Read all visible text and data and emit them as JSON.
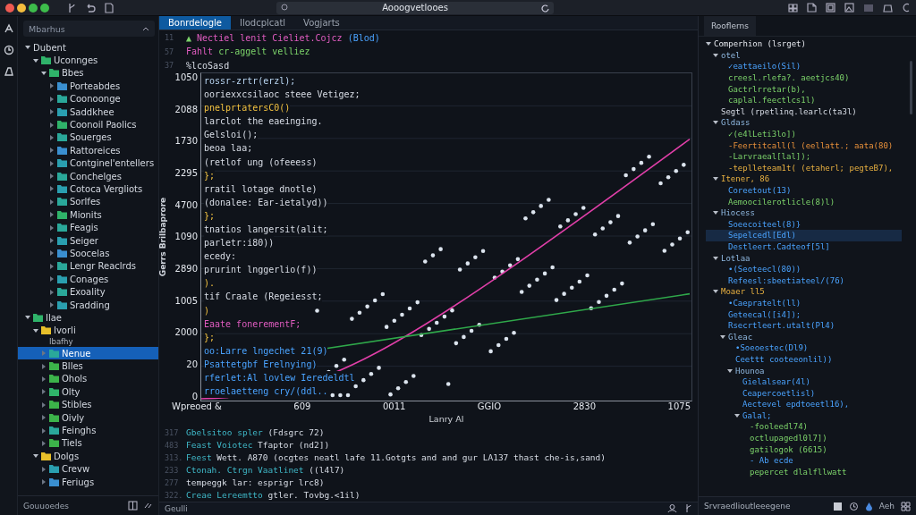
{
  "titlebar": {
    "search_value": "Aooogvetlooes"
  },
  "sidebar": {
    "search_placeholder": "Mbarhus",
    "status": "Gouuoedes",
    "tree": [
      {
        "label": "Dubent",
        "expanded": true,
        "selected": false,
        "children": [
          {
            "label": "Uconnges",
            "expanded": true,
            "selected": false,
            "color": "#2fb36a",
            "children": [
              {
                "label": "Bbes",
                "expanded": true,
                "selected": false,
                "color": "#2fb36a",
                "children": [
                  {
                    "label": "Porteabdes",
                    "expanded": false,
                    "selected": false,
                    "color": "#3a8fd0"
                  },
                  {
                    "label": "Coonoonge",
                    "expanded": false,
                    "selected": false,
                    "color": "#2aa89a"
                  },
                  {
                    "label": "Saddkhee",
                    "expanded": false,
                    "selected": false,
                    "color": "#2a9fb0"
                  },
                  {
                    "label": "Coonoil Paolics",
                    "expanded": false,
                    "selected": false,
                    "color": "#2fb36a"
                  },
                  {
                    "label": "Souerges",
                    "expanded": false,
                    "selected": false,
                    "color": "#2aa89a"
                  },
                  {
                    "label": "Rattoreices",
                    "expanded": false,
                    "selected": false,
                    "color": "#3a8fd0"
                  },
                  {
                    "label": "Contginel'entellers",
                    "expanded": false,
                    "selected": false,
                    "color": "#2a9fb0"
                  },
                  {
                    "label": "Conchelges",
                    "expanded": false,
                    "selected": false,
                    "color": "#2aa89a"
                  },
                  {
                    "label": "Cotoca Vergliots",
                    "expanded": false,
                    "selected": false,
                    "color": "#2a9fb0"
                  },
                  {
                    "label": "Sorlfes",
                    "expanded": false,
                    "selected": false,
                    "color": "#2aa89a"
                  },
                  {
                    "label": "Mionits",
                    "expanded": false,
                    "selected": false,
                    "color": "#2fb36a"
                  },
                  {
                    "label": "Feagis",
                    "expanded": false,
                    "selected": false,
                    "color": "#2aa89a"
                  },
                  {
                    "label": "Seiger",
                    "expanded": false,
                    "selected": false,
                    "color": "#2a9fb0"
                  },
                  {
                    "label": "Soocelas",
                    "expanded": false,
                    "selected": false,
                    "color": "#3a8fd0"
                  },
                  {
                    "label": "Lengr Reaclrds",
                    "expanded": false,
                    "selected": false,
                    "color": "#2aa89a"
                  },
                  {
                    "label": "Conages",
                    "expanded": false,
                    "selected": false,
                    "color": "#2a9fb0"
                  },
                  {
                    "label": "Exoality",
                    "expanded": false,
                    "selected": false,
                    "color": "#2aa89a"
                  },
                  {
                    "label": "Sradding",
                    "expanded": false,
                    "selected": false,
                    "color": "#2a9fb0"
                  }
                ]
              }
            ]
          }
        ]
      },
      {
        "label": "Ilae",
        "expanded": true,
        "selected": false,
        "color": "#2fb36a",
        "children": [
          {
            "label": "Ivorli",
            "detail": "Ibafhy",
            "expanded": true,
            "selected": false,
            "color": "#e8c02a",
            "children": [
              {
                "label": "Nenue",
                "expanded": false,
                "selected": true,
                "color": "#2aa89a"
              },
              {
                "label": "Blles",
                "expanded": false,
                "selected": false,
                "color": "#3cb34a"
              },
              {
                "label": "Ohols",
                "expanded": false,
                "selected": false,
                "color": "#3cb34a"
              },
              {
                "label": "Olty",
                "expanded": false,
                "selected": false,
                "color": "#2fb36a"
              },
              {
                "label": "Stibles",
                "expanded": false,
                "selected": false,
                "color": "#3cb34a"
              },
              {
                "label": "Oivly",
                "expanded": false,
                "selected": false,
                "color": "#3cb34a"
              },
              {
                "label": "Feinghs",
                "expanded": false,
                "selected": false,
                "color": "#2aa89a"
              },
              {
                "label": "Tiels",
                "expanded": false,
                "selected": false,
                "color": "#3cb34a"
              }
            ]
          },
          {
            "label": "Dolgs",
            "expanded": true,
            "selected": false,
            "color": "#e8c02a",
            "children": [
              {
                "label": "Crevw",
                "expanded": false,
                "selected": false,
                "color": "#2a9fb0"
              },
              {
                "label": "Feriugs",
                "expanded": false,
                "selected": false,
                "color": "#3a8fd0"
              }
            ]
          }
        ]
      }
    ]
  },
  "editor": {
    "tabs": [
      {
        "label": "Bonrdelogle",
        "selected": true
      },
      {
        "label": "Ilodcplcatl",
        "selected": false
      },
      {
        "label": "Vogjarts",
        "selected": false
      }
    ],
    "top_lines": [
      {
        "number": "11",
        "segments": [
          {
            "text": "▲ ",
            "kind": "string"
          },
          {
            "text": "Nectiel lenit Cieliet.Cojcz ",
            "kind": "keyword"
          },
          {
            "text": "(Blod)",
            "kind": "func"
          }
        ]
      },
      {
        "number": "57",
        "segments": [
          {
            "text": "Fahlt ",
            "kind": "keyword"
          },
          {
            "text": "cr-aggelt velliez",
            "kind": "string"
          }
        ]
      },
      {
        "number": "37",
        "segments": [
          {
            "text": "%lcoSasd",
            "kind": "plain"
          }
        ]
      }
    ],
    "chart": {
      "ylabel": "Gerrs Brilbaprore",
      "xlabel": "Lanry Al",
      "y_tick_labels": [
        "1050",
        "2088",
        "1730",
        "2295",
        "4700",
        "1090",
        "2890",
        "1005",
        "2000",
        "20",
        "0"
      ],
      "x_tick_labels": [
        "Wpreoed &",
        "609",
        "0011",
        "GGIO",
        "2830",
        "1075"
      ],
      "code_lines": [
        {
          "segments": [
            {
              "text": "rossr-zrtr(erzl);",
              "kind": "light"
            }
          ]
        },
        {
          "segments": [
            {
              "text": "ooriexxcsilaoc steee Vetigez;",
              "kind": "plain"
            }
          ]
        },
        {
          "segments": [
            {
              "text": "pnelprtatersC0()",
              "kind": "punct"
            }
          ]
        },
        {
          "segments": [
            {
              "text": "larclot the eaeinging.",
              "kind": "plain"
            }
          ]
        },
        {
          "segments": [
            {
              "text": "Gelsloi();",
              "kind": "plain"
            }
          ]
        },
        {
          "segments": [
            {
              "text": "beoa laa;",
              "kind": "plain"
            }
          ]
        },
        {
          "segments": [
            {
              "text": "(retlof ung (ofeeess)",
              "kind": "plain"
            }
          ]
        },
        {
          "segments": [
            {
              "text": "};",
              "kind": "punct"
            }
          ]
        },
        {
          "segments": [
            {
              "text": "rratil lotage dnotle)",
              "kind": "plain"
            }
          ]
        },
        {
          "segments": [
            {
              "text": "(donalee: Ear-ietalyd))",
              "kind": "plain"
            }
          ]
        },
        {
          "segments": [
            {
              "text": "};",
              "kind": "punct"
            }
          ]
        },
        {
          "segments": [
            {
              "text": "tnatios langersit(alit;",
              "kind": "plain"
            }
          ]
        },
        {
          "segments": [
            {
              "text": "parletr:i80))",
              "kind": "plain"
            }
          ]
        },
        {
          "segments": [
            {
              "text": "ecedy:",
              "kind": "plain"
            }
          ]
        },
        {
          "segments": [
            {
              "text": "prurint lnggerlio(f))",
              "kind": "plain"
            }
          ]
        },
        {
          "segments": [
            {
              "text": ").",
              "kind": "punct"
            }
          ]
        },
        {
          "segments": [
            {
              "text": "tif Craale (Regeiesst;",
              "kind": "plain"
            }
          ]
        },
        {
          "segments": [
            {
              "text": ")",
              "kind": "punct"
            }
          ]
        },
        {
          "segments": [
            {
              "text": "Eaate fonerementF;",
              "kind": "keyword"
            }
          ]
        },
        {
          "segments": [
            {
              "text": "};",
              "kind": "punct"
            }
          ]
        },
        {
          "segments": [
            {
              "text": "oo:Larre lngechet 21(9)",
              "kind": "func"
            }
          ]
        },
        {
          "segments": [
            {
              "text": "Psattetgbf Erelnying)",
              "kind": "func"
            }
          ]
        },
        {
          "segments": [
            {
              "text": "rferlet:Al lovlew Ieredeldtl",
              "kind": "func"
            }
          ]
        },
        {
          "segments": [
            {
              "text": "rroelaetteng cry/(ddl..",
              "kind": "func"
            }
          ]
        }
      ]
    },
    "bottom_lines": [
      {
        "number": "317",
        "segments": [
          {
            "text": "Gbelsitoo spler ",
            "kind": "type"
          },
          {
            "text": "(Fdsgrc 72)",
            "kind": "plain"
          }
        ]
      },
      {
        "number": "483",
        "segments": [
          {
            "text": "Feast Voiotec ",
            "kind": "type"
          },
          {
            "text": "Tfaptor (nd2])",
            "kind": "plain"
          }
        ]
      },
      {
        "number": "313.",
        "segments": [
          {
            "text": "Feest ",
            "kind": "type"
          },
          {
            "text": "Wett. A870 (ocgtes neatl lafe 11.Gotgts and and gur LA137 thast che-is,sand)",
            "kind": "plain"
          }
        ]
      },
      {
        "number": "233",
        "segments": [
          {
            "text": "Ctonah. Ctrgn Vaatlinet ",
            "kind": "type"
          },
          {
            "text": "((l4l7)",
            "kind": "plain"
          }
        ]
      },
      {
        "number": "277",
        "segments": [
          {
            "text": "tempeggk lar: esprigr lrc8)",
            "kind": "plain"
          }
        ]
      },
      {
        "number": "322.",
        "segments": [
          {
            "text": "Creae Lereemtto ",
            "kind": "type"
          },
          {
            "text": "gtler. Tovbg.<1il)",
            "kind": "plain"
          }
        ]
      }
    ],
    "status": "Geulli"
  },
  "outline": {
    "tab": "Rooflerns",
    "status": "Srvraedlioutleeegene",
    "status_right": "Aeh",
    "items": [
      {
        "text": "Comperhion (lsrget)",
        "kind": "title",
        "expanded": true,
        "selected": false,
        "children": [
          {
            "text": "otel",
            "kind": "group",
            "expanded": true,
            "selected": false,
            "children": [
              {
                "text": "✓eattaeilo(Sil)",
                "kind": "func",
                "selected": false
              },
              {
                "text": "creesl.rlefa?. aeetjcs40)",
                "kind": "string",
                "selected": false
              },
              {
                "text": "Gactrlrretar(b),",
                "kind": "string",
                "selected": false
              },
              {
                "text": "caplal.feectlcs1l)",
                "kind": "string",
                "selected": false
              }
            ]
          },
          {
            "text": "Segtl (rpetlinq.learlc(ta3l)",
            "kind": "plain",
            "selected": false
          },
          {
            "text": "Gldass",
            "kind": "group",
            "expanded": true,
            "selected": false,
            "children": [
              {
                "text": "✓(e4lLeti3lo])",
                "kind": "string",
                "selected": false
              },
              {
                "text": "-Feertitcall(l (eellatt.; aata(80)",
                "kind": "number",
                "selected": false
              },
              {
                "text": "-Larvraeal[lal]);",
                "kind": "string",
                "selected": false
              },
              {
                "text": "-teplleteam1t( (etaherl; pegteB7),",
                "kind": "attr",
                "selected": false
              }
            ]
          },
          {
            "text": "Itener, 86",
            "kind": "attr",
            "expanded": true,
            "selected": false,
            "children": [
              {
                "text": "Coreetout(13)",
                "kind": "func",
                "selected": false
              },
              {
                "text": "Aemoocilerotlicle(8)l)",
                "kind": "string",
                "selected": false
              }
            ]
          },
          {
            "text": "Hiocess",
            "kind": "group",
            "expanded": true,
            "selected": false,
            "children": [
              {
                "text": "Soeecoiteel(8)}",
                "kind": "func",
                "selected": false
              },
              {
                "text": "Sepelcedl[Edl)",
                "kind": "func",
                "selected": true
              },
              {
                "text": "Destleert.Cadteof[5l]",
                "kind": "func",
                "selected": false
              }
            ]
          },
          {
            "text": "Lotlaa",
            "kind": "group",
            "expanded": true,
            "selected": false,
            "children": [
              {
                "text": "•(Seoteecl(80))",
                "kind": "func",
                "selected": false
              },
              {
                "text": "Refeesl:sbeetiateel/(76)",
                "kind": "func",
                "selected": false
              }
            ]
          },
          {
            "text": "Moaer ll5",
            "kind": "attr",
            "expanded": true,
            "selected": false,
            "children": [
              {
                "text": "•Caepratelt(ll)",
                "kind": "func",
                "selected": false
              },
              {
                "text": "Geteecal([i4]);",
                "kind": "func",
                "selected": false
              },
              {
                "text": "Rsecrtleert.utalt(Pl4)",
                "kind": "func",
                "selected": false
              },
              {
                "text": "Gleac",
                "kind": "group",
                "expanded": true,
                "selected": false,
                "children": [
                  {
                    "text": "•Soeoestec(Dl9)",
                    "kind": "func",
                    "selected": false
                  },
                  {
                    "text": "Ceettt cooteeonlil))",
                    "kind": "func",
                    "selected": false
                  },
                  {
                    "text": "Hounoa",
                    "kind": "group",
                    "expanded": true,
                    "selected": false,
                    "children": [
                      {
                        "text": "Gielalsear(4l)",
                        "kind": "func",
                        "selected": false
                      },
                      {
                        "text": "Ceapercoetlisl)",
                        "kind": "func",
                        "selected": false
                      },
                      {
                        "text": "Aectevel epdtoeetl16),",
                        "kind": "func",
                        "selected": false
                      },
                      {
                        "text": "Galal;",
                        "kind": "func",
                        "expanded": true,
                        "selected": false,
                        "children": [
                          {
                            "text": "-fooleedl74)",
                            "kind": "string",
                            "selected": false
                          },
                          {
                            "text": "octlupagedl0l7])",
                            "kind": "string",
                            "selected": false
                          },
                          {
                            "text": "gatilogok (6615)",
                            "kind": "string",
                            "selected": false
                          },
                          {
                            "text": "- Ab ecde",
                            "kind": "func",
                            "selected": false
                          },
                          {
                            "text": "pepercet dlalfllwatt",
                            "kind": "string",
                            "selected": false
                          }
                        ]
                      }
                    ]
                  }
                ]
              }
            ]
          }
        ]
      }
    ]
  }
}
